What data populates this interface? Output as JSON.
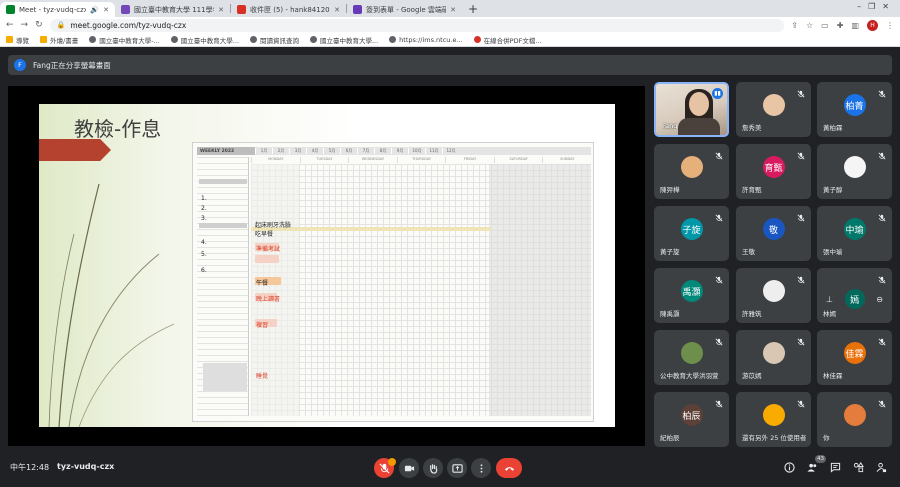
{
  "browser": {
    "tabs": [
      {
        "label": "Meet - tyz-vudq-czx",
        "active": true,
        "color": "#00832d"
      },
      {
        "label": "國立臺中教育大學 111學年度 英...",
        "active": false,
        "color": "#7248b9"
      },
      {
        "label": "收件匣 (5) - hank841204@ma...",
        "active": false,
        "color": "#d93025"
      },
      {
        "label": "簽到表單 - Google 雲端硬碟",
        "active": false,
        "color": "#673ab7"
      }
    ],
    "url": "meet.google.com/tyz-vudq-czx",
    "profile_initial": "H",
    "bookmarks": [
      {
        "label": "導覽",
        "icon": "apps-icon"
      },
      {
        "label": "外燴/書畫",
        "icon": "folder-icon"
      },
      {
        "label": "國立臺中教育大學-...",
        "icon": "globe-icon"
      },
      {
        "label": "國立臺中教育大學...",
        "icon": "globe-icon"
      },
      {
        "label": "閱讀資訊查詢",
        "icon": "globe-icon"
      },
      {
        "label": "國立臺中教育大學...",
        "icon": "globe-icon"
      },
      {
        "label": "https://ims.ntcu.e...",
        "icon": "globe-icon"
      },
      {
        "label": "在線合併PDF文檔...",
        "icon": "pdf-icon"
      }
    ]
  },
  "notice": {
    "avatar": "F",
    "text": "Fang正在分享螢幕畫面"
  },
  "slide": {
    "title": "教檢-作息",
    "planner": {
      "header": "WEEKLY 2022",
      "months": [
        "1月",
        "2月",
        "3月",
        "4月",
        "5月",
        "6月",
        "7月",
        "8月",
        "9月",
        "10月",
        "11月",
        "12月"
      ],
      "days": [
        "MONDAY",
        "TUESDAY",
        "WEDNESDAY",
        "THURSDAY",
        "FRIDAY",
        "SATURDAY",
        "SUNDAY"
      ],
      "notes": [
        "1.",
        "2.",
        "3.",
        "4.",
        "5.",
        "6."
      ],
      "handwriting": [
        "起床刷牙洗臉",
        "吃早餐",
        "準備考試",
        "午餐",
        "晚上讀書",
        "複習",
        "睡覺"
      ]
    }
  },
  "participants": [
    {
      "name": "Fang",
      "avatar": "",
      "color": "",
      "video": true
    },
    {
      "name": "詹秀美",
      "avatar": "",
      "color": "#e8c5a5",
      "video": false
    },
    {
      "name": "黃柏霖",
      "avatar": "柏菁",
      "color": "#1a73e8",
      "video": false
    },
    {
      "name": "陳羿樺",
      "avatar": "",
      "color": "#e5b07a",
      "video": false
    },
    {
      "name": "許育甄",
      "avatar": "育甄",
      "color": "#d81b60",
      "video": false
    },
    {
      "name": "黃子醇",
      "avatar": "",
      "color": "#f5f5f5",
      "video": false
    },
    {
      "name": "黃子旋",
      "avatar": "子旋",
      "color": "#0097a7",
      "video": false
    },
    {
      "name": "王敬",
      "avatar": "敬",
      "color": "#1a56c2",
      "video": false
    },
    {
      "name": "張中瑜",
      "avatar": "中瑜",
      "color": "#00796b",
      "video": false
    },
    {
      "name": "陳禹灝",
      "avatar": "禹灝",
      "color": "#00897b",
      "video": false
    },
    {
      "name": "許雅筑",
      "avatar": "",
      "color": "#eeeeee",
      "video": false
    },
    {
      "name": "林嫣",
      "avatar": "嫣",
      "color": "#00695c",
      "video": false
    },
    {
      "name": "公中教育大學洪羽萱",
      "avatar": "",
      "color": "#6d8f4b",
      "video": false
    },
    {
      "name": "游苡嫣",
      "avatar": "",
      "color": "#d9c7b3",
      "video": false
    },
    {
      "name": "林佳霖",
      "avatar": "佳霖",
      "color": "#e8710a",
      "video": false
    },
    {
      "name": "紀柏辰",
      "avatar": "柏辰",
      "color": "#5d4037",
      "video": false
    },
    {
      "name": "還有另外 25 位使用者",
      "avatar": "",
      "color": "#f9ab00",
      "video": false
    },
    {
      "name": "你",
      "avatar": "",
      "color": "#e37c3c",
      "video": false
    }
  ],
  "bottom": {
    "time": "中午12:48",
    "meeting_code": "tyz-vudq-czx",
    "people_count": "43"
  },
  "colors": {
    "meet_bg": "#202124",
    "tile_bg": "#3c4043",
    "end_call": "#ea4335",
    "active_speaker": "#1a73e8"
  }
}
